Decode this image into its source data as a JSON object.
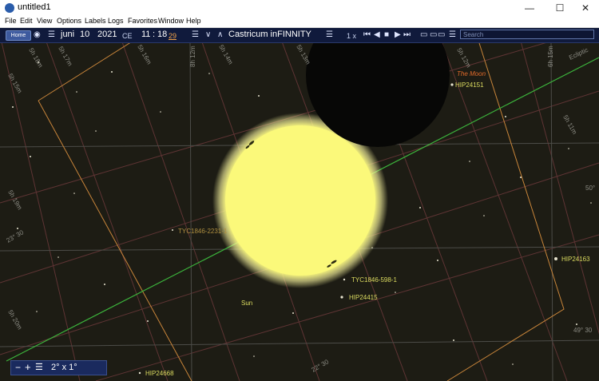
{
  "window": {
    "title": "untitled1",
    "controls": [
      "minimize-icon",
      "maximize-icon",
      "close-icon"
    ]
  },
  "menu": {
    "items": [
      "File",
      "Edit",
      "View",
      "Options",
      "Labels",
      "Logs",
      "Favorites",
      "Window",
      "Help"
    ]
  },
  "toolbar": {
    "home_label": "Home",
    "month": "juni",
    "day": "10",
    "year": "2021",
    "era": "CE",
    "hour": "11",
    "minute": "18",
    "seconds": "29",
    "location": "Castricum inFINNITY",
    "time_rate": "1 x",
    "search_placeholder": "Search"
  },
  "sky": {
    "grid_labels": [
      "5h 17m",
      "5h 16m",
      "5h 15m",
      "5h 14m",
      "5h 13m",
      "5h 12m",
      "5h 11m",
      "5h 18m",
      "5h 19m",
      "5h 20m",
      "8h 12m",
      "6h 15m",
      "23° 30",
      "22° 30",
      "50°",
      "49° 30"
    ],
    "ecliptic_label": "Ecliptic",
    "objects": {
      "moon": "The Moon",
      "sun": "Sun",
      "hip24151": "HIP24151",
      "hip24163": "HIP24163",
      "hip24415": "HIP24415",
      "hip24668": "HIP24668",
      "tyc1846_2231": "TYC1846-2231-1",
      "tyc1846_598": "TYC1846-598-1"
    }
  },
  "zoom": {
    "fov": "2° x 1°"
  },
  "colors": {
    "ecliptic": "#3cb43c",
    "sun": "#fbf97a",
    "moon_label": "#e06a2a",
    "star_label": "#dcdc60",
    "grid": "#6a3a3a",
    "constellation": "#c8853a"
  }
}
